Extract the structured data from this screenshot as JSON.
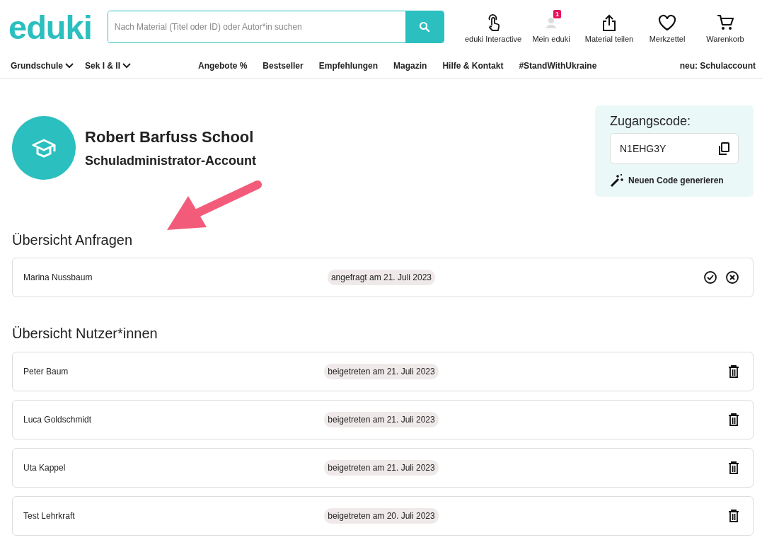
{
  "header": {
    "logo": "eduki",
    "search": {
      "placeholder": "Nach Material (Titel oder ID) oder Autor*in suchen"
    },
    "actions": [
      {
        "kind": "touch",
        "label": "eduki Interactive"
      },
      {
        "kind": "user",
        "label": "Mein eduki",
        "badge": "1"
      },
      {
        "kind": "share",
        "label": "Material teilen"
      },
      {
        "kind": "heart",
        "label": "Merkzettel"
      },
      {
        "kind": "cart",
        "label": "Warenkorb"
      }
    ]
  },
  "nav": {
    "left": [
      "Grundschule",
      "Sek I & II"
    ],
    "middle": [
      "Angebote %",
      "Bestseller",
      "Empfehlungen",
      "Magazin",
      "Hilfe & Kontakt",
      "#StandWithUkraine"
    ],
    "right": "neu: Schulaccount"
  },
  "school": {
    "name": "Robert Barfuss School",
    "role": "Schuladministrator-Account"
  },
  "access": {
    "title": "Zugangscode:",
    "code": "N1EHG3Y",
    "generate": "Neuen Code generieren"
  },
  "requests": {
    "title": "Übersicht Anfragen",
    "rows": [
      {
        "name": "Marina Nussbaum",
        "status": "angefragt am 21. Juli 2023",
        "kind": "request"
      }
    ]
  },
  "users": {
    "title": "Übersicht Nutzer*innen",
    "rows": [
      {
        "name": "Peter Baum",
        "status": "beigetreten am 21. Juli 2023",
        "kind": "member"
      },
      {
        "name": "Luca Goldschmidt",
        "status": "beigetreten am 21. Juli 2023",
        "kind": "member"
      },
      {
        "name": "Uta Kappel",
        "status": "beigetreten am 21. Juli 2023",
        "kind": "member"
      },
      {
        "name": "Test Lehrkraft",
        "status": "beigetreten am 20. Juli 2023",
        "kind": "member"
      }
    ]
  }
}
